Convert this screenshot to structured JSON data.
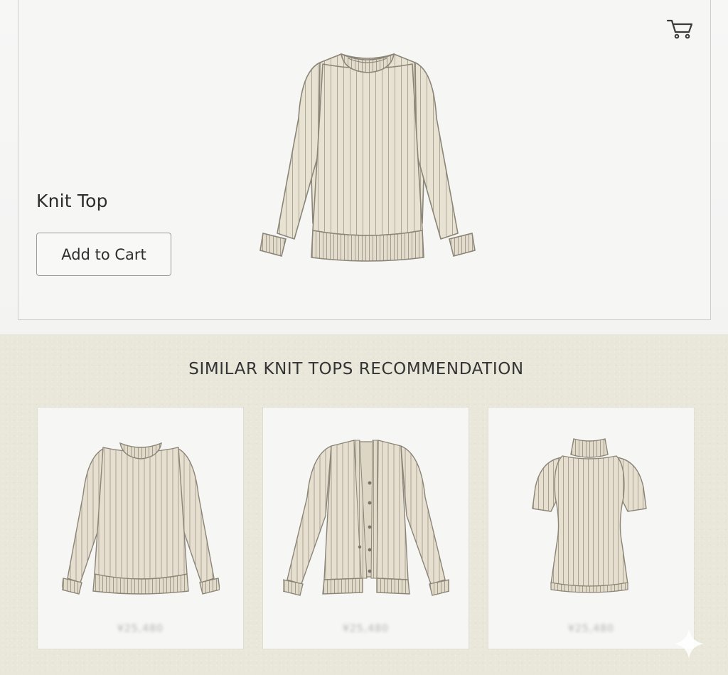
{
  "header": {
    "cart_icon": "shopping-cart-icon"
  },
  "product": {
    "title": "Knit Top",
    "add_to_cart_label": "Add to Cart",
    "image": "ribbed-crewneck-sweater-illustration"
  },
  "recommendations": {
    "heading": "SIMILAR KNIT TOPS RECOMMENDATION",
    "items": [
      {
        "image": "ribbed-crewneck-sweater",
        "price": "¥25,480"
      },
      {
        "image": "ribbed-cardigan",
        "price": "¥25,480"
      },
      {
        "image": "ribbed-mockneck-short-sleeve-top",
        "price": "¥25,480"
      }
    ]
  },
  "colors": {
    "knit_fill": "#e6dfcf",
    "knit_stroke": "#8b8578",
    "rec_background": "#e9e6da"
  }
}
